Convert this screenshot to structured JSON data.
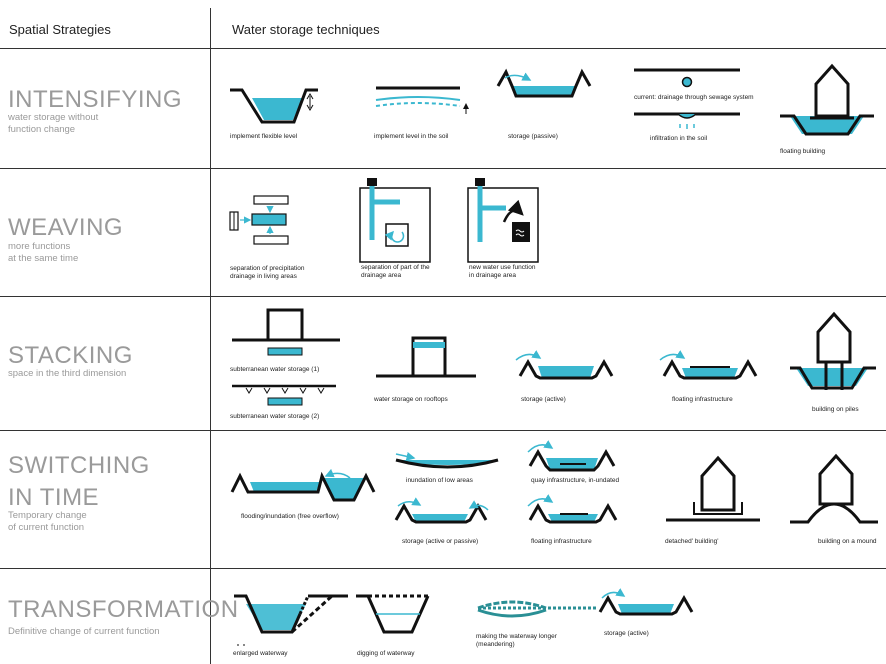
{
  "headers": {
    "left": "Spatial Strategies",
    "right": "Water storage techniques"
  },
  "colors": {
    "water": "#3bb8d0",
    "line": "#111111",
    "category_text": "#9a9a9a",
    "dotted_water": "#2a8f95"
  },
  "rows": [
    {
      "title": "INTENSIFYING",
      "subtitle_lines": [
        "water storage without",
        "function change"
      ],
      "techniques": [
        "implement flexible level",
        "implement level in the soil",
        "storage (passive)",
        "current: drainage through sewage system",
        "infiltration in the soil",
        "floating building"
      ]
    },
    {
      "title": "WEAVING",
      "subtitle_lines": [
        "more functions",
        "at the same time"
      ],
      "techniques": [
        [
          "separation of precipitation",
          "drainage in living areas"
        ],
        [
          "separation of part of the",
          "drainage area"
        ],
        [
          "new water use function",
          "in drainage area"
        ]
      ]
    },
    {
      "title": "STACKING",
      "subtitle_lines": [
        "space in the third dimension"
      ],
      "techniques": [
        "subterranean water storage (1)",
        "subterranean water storage (2)",
        "water storage on rooftops",
        "storage (active)",
        "floating infrastructure",
        "building on piles"
      ]
    },
    {
      "title_lines": [
        "SWITCHING",
        "IN TIME"
      ],
      "subtitle_lines": [
        "Temporary change",
        "of current function"
      ],
      "techniques": [
        "flooding/inundation (free overflow)",
        "inundation of low areas",
        "quay infrastructure, in-undated",
        "storage (active or passive)",
        "floating infrastructure",
        "detached' building'",
        "building on a mound"
      ]
    },
    {
      "title": "TRANSFORMATION",
      "subtitle_lines": [
        "Definitive change of current function"
      ],
      "techniques": [
        "enlarged waterway",
        "digging of waterway",
        [
          "making the waterway longer",
          "(meandering)"
        ],
        "storage (active)"
      ]
    }
  ]
}
